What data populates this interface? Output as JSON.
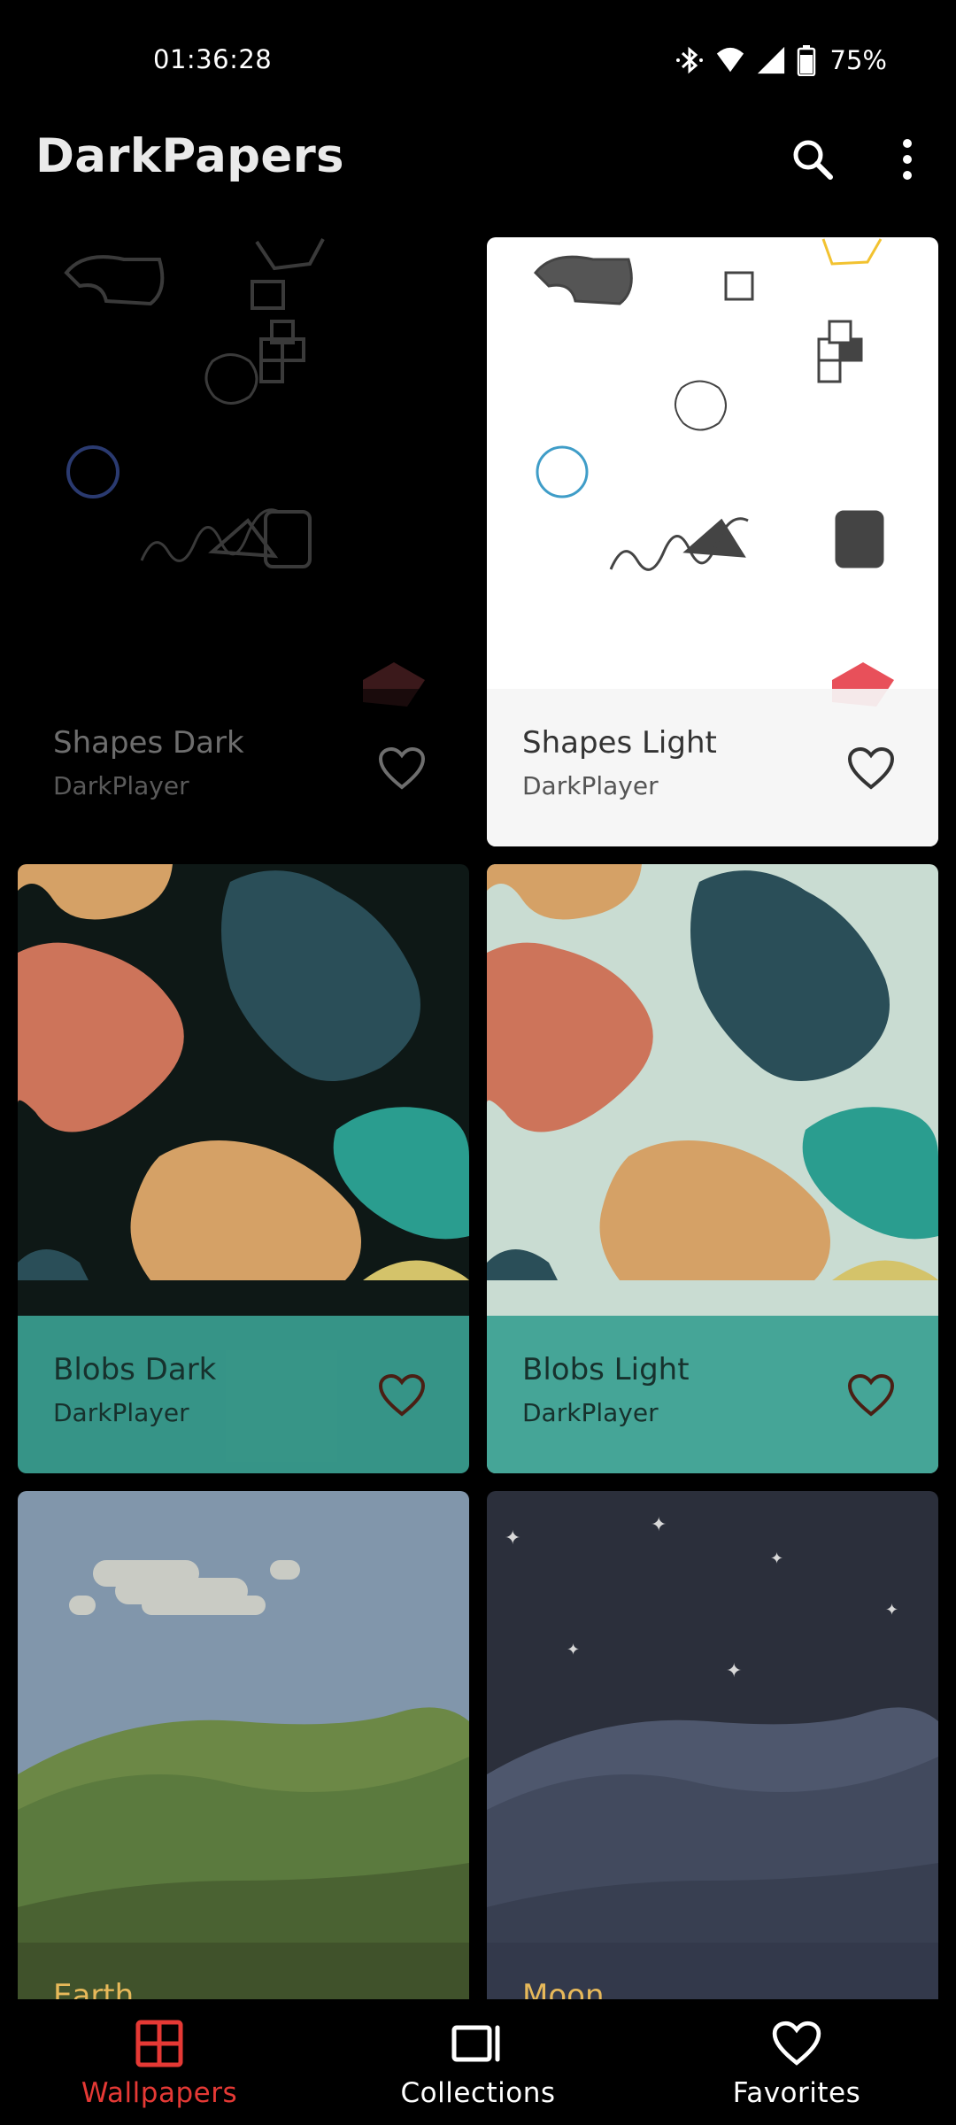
{
  "status_bar": {
    "time": "01:36:28",
    "battery": "75%",
    "icons": [
      "bluetooth-icon",
      "wifi-icon",
      "cell-signal-icon",
      "battery-icon"
    ]
  },
  "app_bar": {
    "title": "DarkPapers",
    "actions": [
      "search-icon",
      "more-vert-icon"
    ]
  },
  "wallpapers": [
    {
      "title": "Shapes Dark",
      "author": "DarkPlayer"
    },
    {
      "title": "Shapes Light",
      "author": "DarkPlayer"
    },
    {
      "title": "Blobs Dark",
      "author": "DarkPlayer"
    },
    {
      "title": "Blobs Light",
      "author": "DarkPlayer"
    },
    {
      "title": "Earth",
      "author": ""
    },
    {
      "title": "Moon",
      "author": ""
    }
  ],
  "bottom_nav": {
    "items": [
      {
        "label": "Wallpapers",
        "icon": "grid-icon",
        "active": true
      },
      {
        "label": "Collections",
        "icon": "collections-icon",
        "active": false
      },
      {
        "label": "Favorites",
        "icon": "heart-icon",
        "active": false
      }
    ]
  },
  "colors": {
    "accent": "#e53935",
    "background": "#000000",
    "teal_footer": "#3aa091",
    "blob_orange": "#cd745a",
    "blob_sand": "#d5a166",
    "blob_navy": "#2a4e58",
    "blob_teal": "#2a9d8f",
    "blob_yellow": "#d4c36a",
    "earth_sky": "#8196ab",
    "moon_sky": "#2b2f3b"
  }
}
